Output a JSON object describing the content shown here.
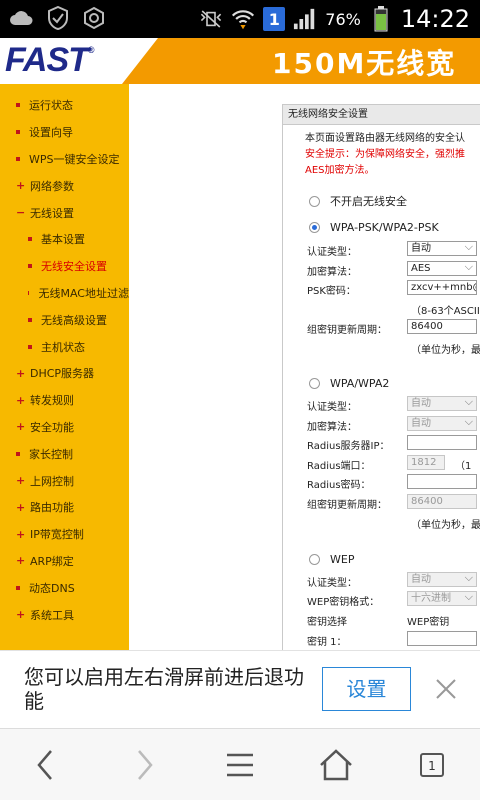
{
  "status_bar": {
    "battery_percent": "76%",
    "clock": "14:22",
    "notification_badge": "1",
    "icons": [
      "cloud-icon",
      "shield-check-icon",
      "settings-hex-icon",
      "mute-vibrate-icon",
      "wifi-icon",
      "sim-1-icon",
      "signal-icon",
      "battery-icon"
    ]
  },
  "header": {
    "logo": "FAST",
    "banner_title": "150M无线宽"
  },
  "sidebar": {
    "items": [
      {
        "label": "运行状态",
        "level": 1
      },
      {
        "label": "设置向导",
        "level": 1
      },
      {
        "label": "WPS一键安全设定",
        "level": 1
      },
      {
        "label": "网络参数",
        "level": 1
      },
      {
        "label": "无线设置",
        "level": 1
      },
      {
        "label": "基本设置",
        "level": 2
      },
      {
        "label": "无线安全设置",
        "level": 2,
        "active": true
      },
      {
        "label": "无线MAC地址过滤",
        "level": 2
      },
      {
        "label": "无线高级设置",
        "level": 2
      },
      {
        "label": "主机状态",
        "level": 2
      },
      {
        "label": "DHCP服务器",
        "level": 1
      },
      {
        "label": "转发规则",
        "level": 1
      },
      {
        "label": "安全功能",
        "level": 1
      },
      {
        "label": "家长控制",
        "level": 1
      },
      {
        "label": "上网控制",
        "level": 1
      },
      {
        "label": "路由功能",
        "level": 1
      },
      {
        "label": "IP带宽控制",
        "level": 1
      },
      {
        "label": "ARP绑定",
        "level": 1
      },
      {
        "label": "动态DNS",
        "level": 1
      },
      {
        "label": "系统工具",
        "level": 1
      }
    ]
  },
  "panel": {
    "title": "无线网络安全设置",
    "desc_line1": "本页面设置路由器无线网络的安全认",
    "warn_line2": "安全提示：为保障网络安全，强烈推",
    "warn_line3": "AES加密方法。",
    "opt_none": "不开启无线安全",
    "opt_psk": "WPA-PSK/WPA2-PSK",
    "psk": {
      "auth_label": "认证类型：",
      "auth_value": "自动",
      "enc_label": "加密算法：",
      "enc_value": "AES",
      "pwd_label": "PSK密码：",
      "pwd_value": "zxcv++mnb@",
      "pwd_hint": "（8-63个ASCII",
      "renew_label": "组密钥更新周期：",
      "renew_value": "86400",
      "renew_hint": "（单位为秒，最"
    },
    "opt_wpa": "WPA/WPA2",
    "wpa": {
      "auth_label": "认证类型：",
      "auth_value": "自动",
      "enc_label": "加密算法：",
      "enc_value": "自动",
      "radius_ip_label": "Radius服务器IP：",
      "radius_port_label": "Radius端口：",
      "radius_port_value": "1812",
      "radius_port_hint": "（1",
      "radius_pwd_label": "Radius密码：",
      "renew_label": "组密钥更新周期：",
      "renew_value": "86400",
      "renew_hint": "（单位为秒，最"
    },
    "opt_wep": "WEP",
    "wep": {
      "auth_label": "认证类型：",
      "auth_value": "自动",
      "format_label": "WEP密钥格式：",
      "format_value": "十六进制",
      "keysel_label": "密钥选择",
      "keysel_value": "WEP密钥",
      "key1_label": "密钥 1："
    }
  },
  "swipe_hint": {
    "message": "您可以启用左右滑屏前进后退功能",
    "button": "设置"
  },
  "toolbar": {
    "tab_count": "1",
    "buttons": [
      "back-icon",
      "forward-icon",
      "menu-icon",
      "home-icon",
      "tabs-icon"
    ]
  },
  "colors": {
    "sidebar_bg": "#f7b900",
    "banner_orange": "#f39a00",
    "logo_blue": "#1f2a8a",
    "warning_red": "#e00000",
    "active_menu": "#d80000",
    "accent_blue": "#2a87d8"
  }
}
